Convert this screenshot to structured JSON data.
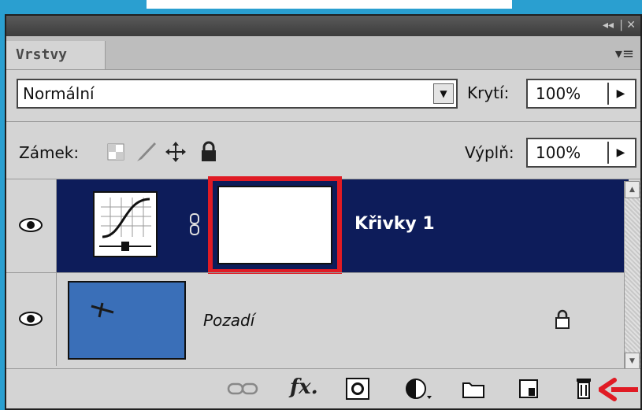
{
  "panel": {
    "tab_title": "Vrstvy",
    "collapse_icon": "double-chevron-left-icon",
    "close_icon": "close-icon",
    "menu_icon": "panel-menu-icon"
  },
  "blend_mode": {
    "value": "Normální"
  },
  "opacity": {
    "label": "Krytí:",
    "value": "100%"
  },
  "lock": {
    "label": "Zámek:"
  },
  "fill": {
    "label": "Výplň:",
    "value": "100%"
  },
  "layers": [
    {
      "name": "Křivky 1",
      "selected": true,
      "type": "curves-adjustment"
    },
    {
      "name": "Pozadí",
      "selected": false,
      "type": "background",
      "locked": true
    }
  ],
  "colors": {
    "accent_bg": "#2a9fd0",
    "selected_layer": "#0d1c5a",
    "mask_highlight": "#e01b24"
  }
}
